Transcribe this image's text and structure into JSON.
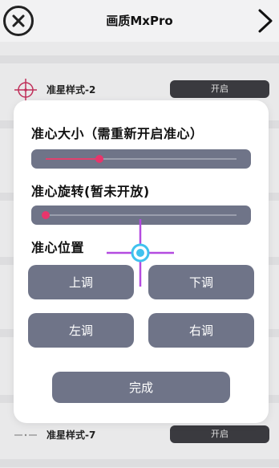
{
  "header": {
    "title": "画质MxPro"
  },
  "list": {
    "items": [
      {
        "label": "准星样式-2",
        "toggle": "开启"
      },
      {
        "label": "准星样式-7",
        "toggle": "开启"
      }
    ]
  },
  "dialog": {
    "size_label": "准心大小（需重新开启准心）",
    "size_value": 0.28,
    "rotate_label": "准心旋转(暂未开放)",
    "rotate_value": 0.0,
    "position_label": "准心位置",
    "buttons": {
      "up": "上调",
      "down": "下调",
      "left": "左调",
      "right": "右调",
      "done": "完成"
    }
  },
  "colors": {
    "accent": "#e8356c",
    "button": "#6f7488",
    "crosshair_line": "#b44be0",
    "crosshair_center": "#3fc1ee"
  }
}
